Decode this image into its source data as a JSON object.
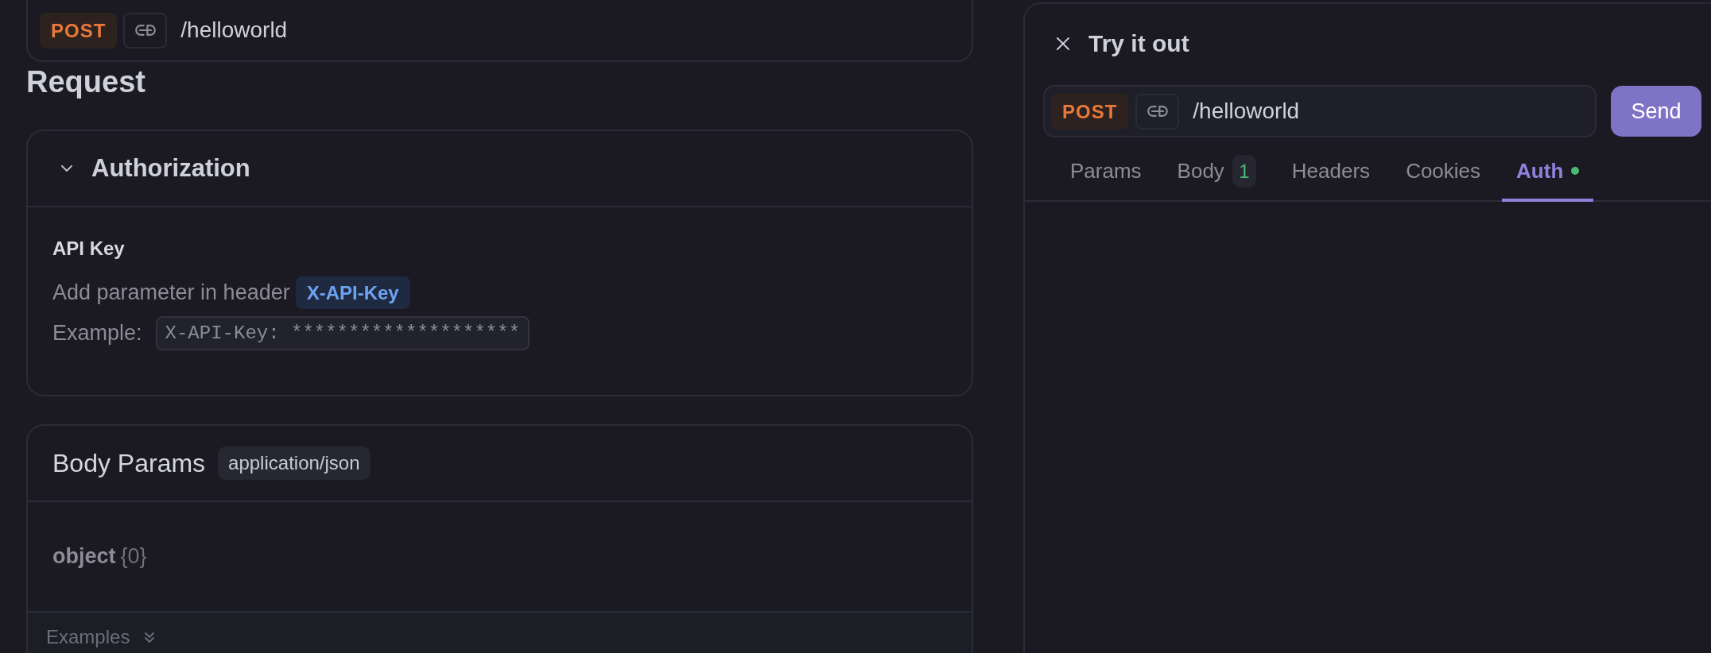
{
  "endpoint": {
    "method": "POST",
    "path": "/helloworld"
  },
  "request": {
    "title": "Request",
    "authorization": {
      "title": "Authorization",
      "expanded": true,
      "scheme": "API Key",
      "description": "Add parameter in header",
      "header_name": "X-API-Key",
      "example_label": "Example:",
      "example_value": "X-API-Key: ********************"
    },
    "body_params": {
      "title": "Body Params",
      "content_type": "application/json",
      "type": "object",
      "count": "{0}",
      "examples_label": "Examples"
    }
  },
  "try_it_out": {
    "title": "Try it out",
    "method": "POST",
    "path": "/helloworld",
    "send_label": "Send",
    "tabs": [
      {
        "label": "Params",
        "selected": false
      },
      {
        "label": "Body",
        "selected": false,
        "badge": "1"
      },
      {
        "label": "Headers",
        "selected": false
      },
      {
        "label": "Cookies",
        "selected": false
      },
      {
        "label": "Auth",
        "selected": true,
        "configured": true
      }
    ]
  }
}
